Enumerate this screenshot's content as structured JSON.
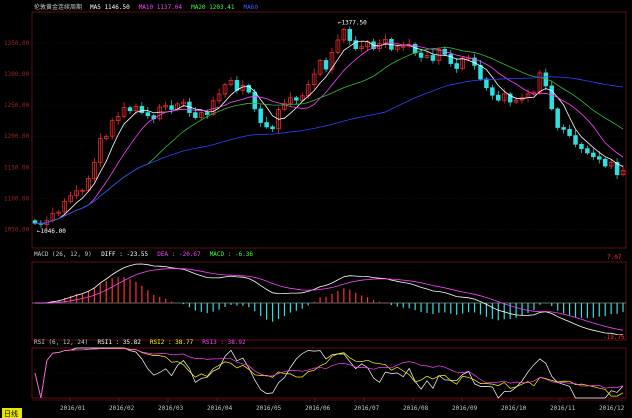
{
  "chart_data": {
    "type": "candlestick",
    "price_panel": {
      "legend": {
        "instrument": "伦敦黄金连续",
        "period": "周期",
        "items": [
          {
            "label": "MA5",
            "value": "1146.50",
            "color": "#ffffff"
          },
          {
            "label": "MA10",
            "value": "1137.04",
            "color": "#ff40ff"
          },
          {
            "label": "MA20",
            "value": "1203.41",
            "color": "#40ff40"
          },
          {
            "label": "MA60",
            "value": "",
            "color": "#4060ff"
          }
        ]
      },
      "high_label": "1377.50",
      "low_label": "1046.00",
      "ma_colors": {
        "ma5": "#ffffff",
        "ma10": "#ff40ff",
        "ma20": "#30c030",
        "ma60": "#3040ff"
      }
    },
    "months": [
      "2016/01",
      "2016/02",
      "2016/03",
      "2016/04",
      "2016/05",
      "2016/06",
      "2016/07",
      "2016/08",
      "2016/09",
      "2016/10",
      "2016/11",
      "2016/12"
    ],
    "closes": [
      1060,
      1058,
      1064,
      1076,
      1078,
      1095,
      1104,
      1112,
      1113,
      1132,
      1158,
      1196,
      1200,
      1225,
      1232,
      1246,
      1241,
      1248,
      1238,
      1233,
      1228,
      1247,
      1249,
      1243,
      1252,
      1255,
      1238,
      1230,
      1238,
      1235,
      1257,
      1268,
      1283,
      1290,
      1274,
      1282,
      1271,
      1244,
      1222,
      1215,
      1212,
      1243,
      1253,
      1262,
      1258,
      1265,
      1283,
      1300,
      1322,
      1308,
      1335,
      1355,
      1372,
      1354,
      1341,
      1344,
      1352,
      1341,
      1349,
      1356,
      1340,
      1344,
      1345,
      1348,
      1334,
      1327,
      1330,
      1322,
      1340,
      1332,
      1317,
      1309,
      1326,
      1326,
      1314,
      1292,
      1278,
      1266,
      1258,
      1268,
      1255,
      1258,
      1262,
      1268,
      1271,
      1302,
      1281,
      1244,
      1214,
      1211,
      1201,
      1187,
      1180,
      1173,
      1167,
      1163,
      1152,
      1158,
      1138,
      1145
    ],
    "macd_panel": {
      "legend": [
        {
          "label": "MACD (26, 12, 9)",
          "color": "#c8c8c8"
        },
        {
          "label": "DIFF : -23.55",
          "color": "#ffffff"
        },
        {
          "label": "DEA : -20.67",
          "color": "#ff40ff"
        },
        {
          "label": "MACD : -6.36",
          "color": "#40ff40"
        }
      ],
      "tag_top": "7.07",
      "tag_bottom": "-19.75"
    },
    "rsi_panel": {
      "legend": [
        {
          "label": "RSI (6, 12, 24)",
          "color": "#c8c8c8"
        },
        {
          "label": "RSI1 : 35.82",
          "color": "#ffffff"
        },
        {
          "label": "RSI2 : 38.77",
          "color": "#ffff00"
        },
        {
          "label": "RSI3 : 38.92",
          "color": "#ff40ff"
        }
      ]
    },
    "corner_button": "日线"
  }
}
